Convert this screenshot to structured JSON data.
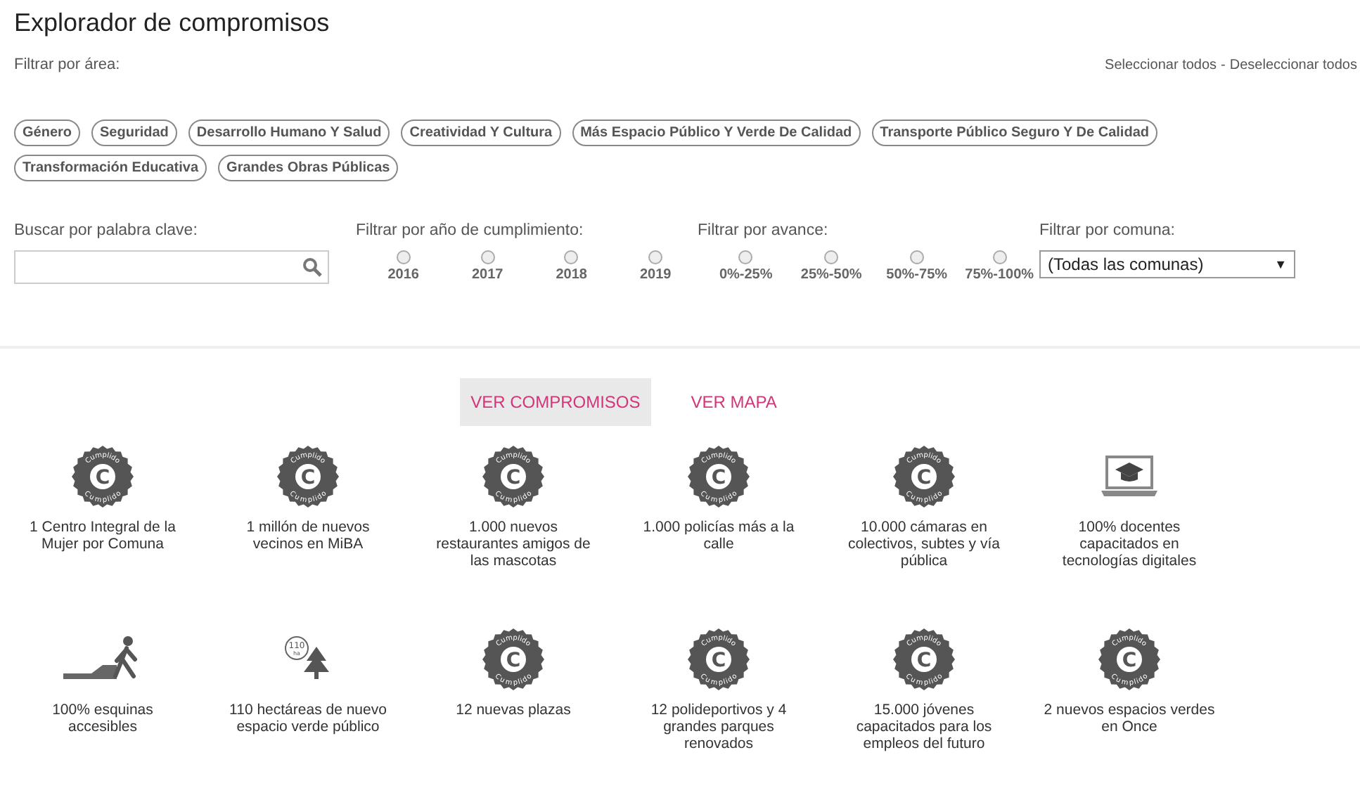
{
  "title": "Explorador de compromisos",
  "area_filter": {
    "label": "Filtrar por área:",
    "select_all": "Seleccionar todos",
    "separator": "-",
    "deselect_all": "Deseleccionar todos",
    "tags": [
      {
        "label": "Género"
      },
      {
        "label": "Seguridad"
      },
      {
        "label": "Desarrollo Humano Y Salud"
      },
      {
        "label": "Creatividad Y Cultura"
      },
      {
        "label": "Más Espacio Público Y Verde De Calidad"
      },
      {
        "label": "Transporte Público Seguro Y De Calidad"
      },
      {
        "label": "Transformación Educativa"
      },
      {
        "label": "Grandes Obras Públicas"
      }
    ]
  },
  "search": {
    "label": "Buscar por palabra clave:"
  },
  "year_filter": {
    "label": "Filtrar por año de cumplimiento:",
    "options": [
      {
        "label": "2016",
        "selected": false
      },
      {
        "label": "2017",
        "selected": false
      },
      {
        "label": "2018",
        "selected": false
      },
      {
        "label": "2019",
        "selected": false
      }
    ]
  },
  "progress_filter": {
    "label": "Filtrar por avance:",
    "options": [
      {
        "label": "0%-25%",
        "selected": false
      },
      {
        "label": "25%-50%",
        "selected": false
      },
      {
        "label": "50%-75%",
        "selected": false
      },
      {
        "label": "75%-100%",
        "selected": false
      }
    ]
  },
  "commune_filter": {
    "label": "Filtrar por comuna:",
    "value": "(Todas las comunas)",
    "arrow": "▼"
  },
  "view_tabs": [
    {
      "label": "VER COMPROMISOS",
      "selected": true
    },
    {
      "label": "VER MAPA",
      "selected": false
    }
  ],
  "commitments": [
    {
      "kind": "badge",
      "badge_letter": "C",
      "badge_labels": [
        "Cumplido",
        "Cumplido"
      ],
      "text": "1 Centro Integral de la Mujer por Comuna"
    },
    {
      "kind": "badge",
      "badge_letter": "C",
      "badge_labels": [
        "Cumplido",
        "Cumplido"
      ],
      "text": "1 millón de nuevos vecinos en MiBA"
    },
    {
      "kind": "badge",
      "badge_letter": "C",
      "badge_labels": [
        "Cumplido",
        "Cumplido"
      ],
      "text": "1.000 nuevos restaurantes amigos de las mascotas"
    },
    {
      "kind": "badge",
      "badge_letter": "C",
      "badge_labels": [
        "Cumplido",
        "Cumplido"
      ],
      "text": "1.000 policías más a la calle"
    },
    {
      "kind": "badge",
      "badge_letter": "C",
      "badge_labels": [
        "Cumplido",
        "Cumplido"
      ],
      "text": "10.000 cámaras en colectivos, subtes y vía pública"
    },
    {
      "kind": "laptop",
      "text": "100% docentes capacitados en tecnologías digitales"
    },
    {
      "kind": "walker",
      "text": "100% esquinas accesibles"
    },
    {
      "kind": "tree",
      "icon_texts": [
        "110",
        "ha"
      ],
      "text": "110 hectáreas de nuevo espacio verde público"
    },
    {
      "kind": "badge",
      "badge_letter": "C",
      "badge_labels": [
        "Cumplido",
        "Cumplido"
      ],
      "text": "12 nuevas plazas"
    },
    {
      "kind": "badge",
      "badge_letter": "C",
      "badge_labels": [
        "Cumplido",
        "Cumplido"
      ],
      "text": "12 polideportivos y 4 grandes parques renovados"
    },
    {
      "kind": "badge",
      "badge_letter": "C",
      "badge_labels": [
        "Cumplido",
        "Cumplido"
      ],
      "text": "15.000 jóvenes capacitados para los empleos del futuro"
    },
    {
      "kind": "badge",
      "badge_letter": "C",
      "badge_labels": [
        "Cumplido",
        "Cumplido"
      ],
      "text": "2 nuevos espacios verdes en Once"
    }
  ]
}
